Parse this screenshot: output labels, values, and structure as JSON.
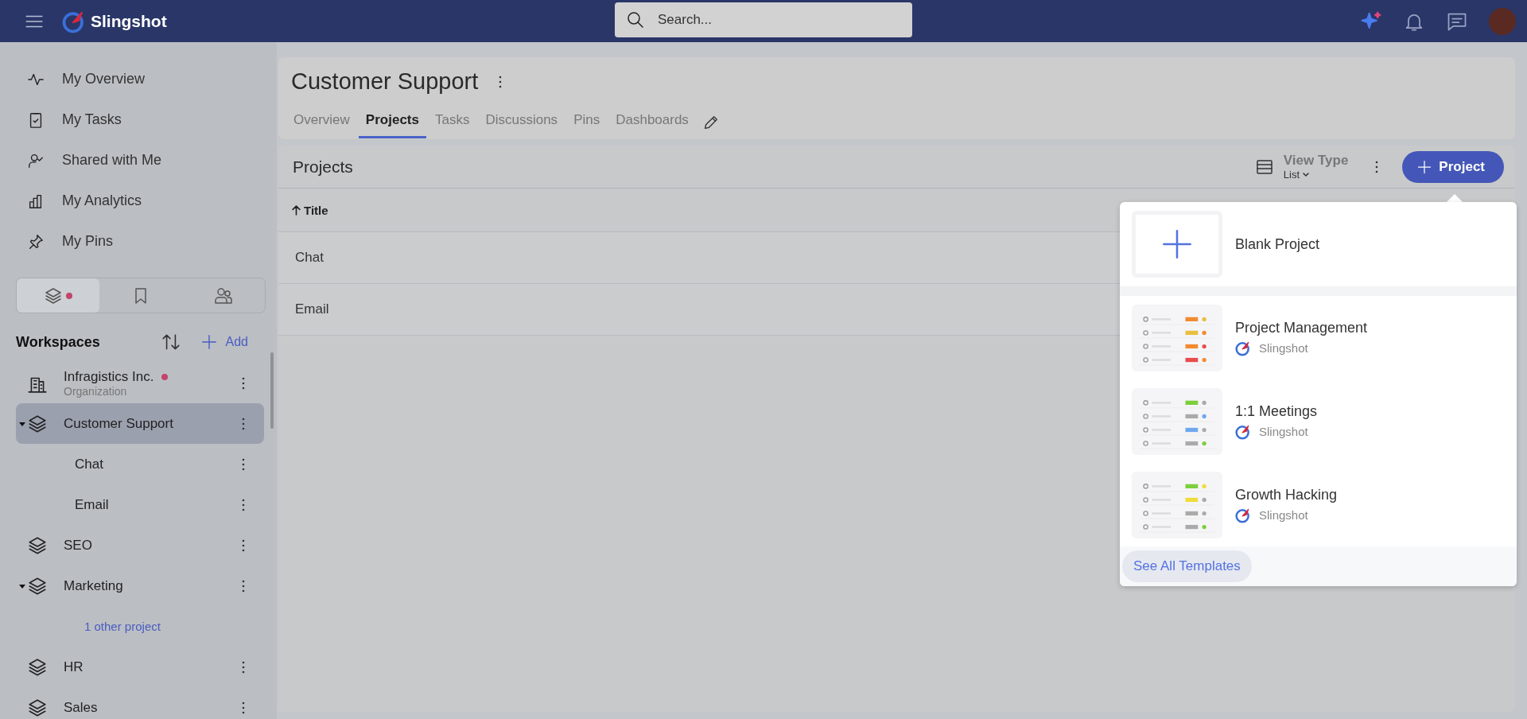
{
  "topbar": {
    "app_name": "Slingshot",
    "search": {
      "placeholder": "Search..."
    }
  },
  "sidebar": {
    "nav": [
      {
        "kind": "overview",
        "label": "My Overview",
        "selected": false
      },
      {
        "kind": "tasks",
        "label": "My Tasks",
        "selected": false
      },
      {
        "kind": "shared",
        "label": "Shared with Me",
        "selected": false
      },
      {
        "kind": "analytics",
        "label": "My Analytics",
        "selected": false
      },
      {
        "kind": "pins",
        "label": "My Pins",
        "selected": false
      }
    ],
    "tabs": [
      {
        "kind": "layers",
        "selected": true,
        "notification": true
      },
      {
        "kind": "bookmark",
        "selected": false,
        "notification": false
      },
      {
        "kind": "people",
        "selected": false,
        "notification": false
      }
    ],
    "workspaces": {
      "title": "Workspaces",
      "add_label": "Add",
      "items": [
        {
          "kind": "organization",
          "label": "Infragistics Inc.",
          "subtitle": "Organization",
          "notification": true,
          "selected": false
        },
        {
          "kind": "workspace",
          "label": "Customer Support",
          "selected": true,
          "expanded": true,
          "children": [
            {
              "label": "Chat"
            },
            {
              "label": "Email"
            }
          ]
        },
        {
          "kind": "workspace",
          "label": "SEO",
          "selected": false,
          "expanded": false
        },
        {
          "kind": "workspace",
          "label": "Marketing",
          "selected": false,
          "expanded": true,
          "more_link": "1 other project"
        },
        {
          "kind": "workspace",
          "label": "HR",
          "selected": false,
          "expanded": false
        },
        {
          "kind": "workspace",
          "label": "Sales",
          "selected": false,
          "expanded": false
        }
      ]
    }
  },
  "main": {
    "title": "Customer Support",
    "tabs": [
      {
        "label": "Overview",
        "selected": false
      },
      {
        "label": "Projects",
        "selected": true
      },
      {
        "label": "Tasks",
        "selected": false
      },
      {
        "label": "Discussions",
        "selected": false
      },
      {
        "label": "Pins",
        "selected": false
      },
      {
        "label": "Dashboards",
        "selected": false
      }
    ],
    "projects": {
      "title": "Projects",
      "view_type": {
        "label": "View Type",
        "value": "List"
      },
      "add_button": "Project",
      "table": {
        "columns": [
          {
            "label": "Title",
            "sorted_ascending": true
          }
        ],
        "rows": [
          "Chat",
          "Email"
        ]
      }
    }
  },
  "new_project_menu": {
    "blank": {
      "label": "Blank Project"
    },
    "templates": [
      {
        "name": "Project Management",
        "author": "Slingshot"
      },
      {
        "name": "1:1 Meetings",
        "author": "Slingshot"
      },
      {
        "name": "Growth Hacking",
        "author": "Slingshot"
      }
    ],
    "footer_link": "See All Templates"
  }
}
